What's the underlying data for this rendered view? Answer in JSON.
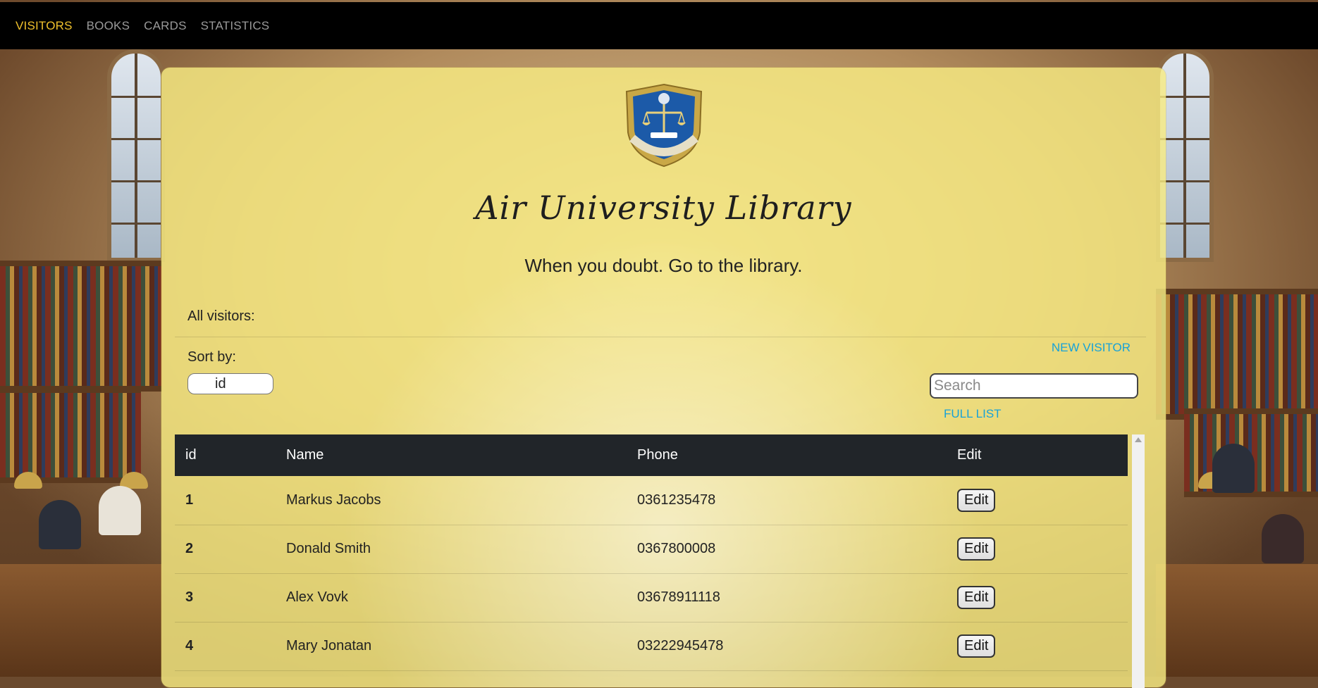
{
  "nav": {
    "items": [
      {
        "label": "VISITORS",
        "active": true
      },
      {
        "label": "BOOKS",
        "active": false
      },
      {
        "label": "CARDS",
        "active": false
      },
      {
        "label": "STATISTICS",
        "active": false
      }
    ]
  },
  "header": {
    "logo_icon": "library-crest-icon",
    "logo_text": "AIR UNIVERSITY LIBRARY",
    "title": "Air University Library",
    "subtitle": "When you doubt. Go to the library."
  },
  "visitors": {
    "section_label": "All visitors:",
    "new_visitor_label": "NEW VISITOR",
    "sort_label": "Sort by:",
    "sort_value": "id",
    "search_placeholder": "Search",
    "full_list_label": "FULL LIST",
    "columns": [
      "id",
      "Name",
      "Phone",
      "Edit"
    ],
    "rows": [
      {
        "id": "1",
        "name": "Markus Jacobs",
        "phone": "0361235478",
        "edit": "Edit"
      },
      {
        "id": "2",
        "name": "Donald Smith",
        "phone": "0367800008",
        "edit": "Edit"
      },
      {
        "id": "3",
        "name": "Alex Vovk",
        "phone": "03678911118",
        "edit": "Edit"
      },
      {
        "id": "4",
        "name": "Mary Jonatan",
        "phone": "03222945478",
        "edit": "Edit"
      }
    ]
  },
  "colors": {
    "nav_active": "#f0c12c",
    "nav_inactive": "#9a9a9a",
    "link": "#17a2d8",
    "table_header": "#212529",
    "card": "#f8ec82"
  }
}
